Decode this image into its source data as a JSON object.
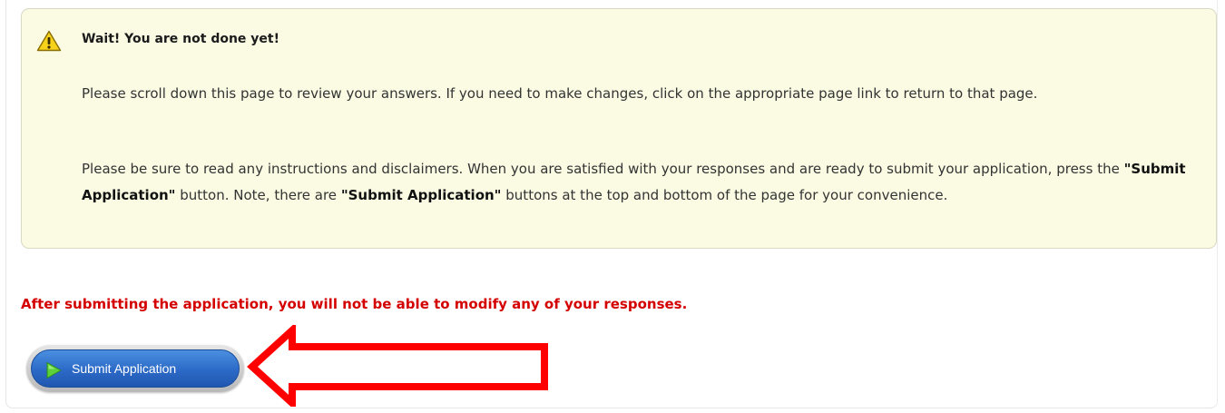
{
  "notice": {
    "icon": "warning-icon",
    "title": "Wait! You are not done yet!",
    "paragraph1": "Please scroll down this page to review your answers. If you need to make changes, click on the appropriate page link to return to that page.",
    "paragraph2_part1": "Please be sure to read any instructions and disclaimers. When you are satisfied with your responses and are ready to submit your application, press the ",
    "paragraph2_bold1": "\"Submit Application\"",
    "paragraph2_part2": " button. Note, there are ",
    "paragraph2_bold2": "\"Submit Application\"",
    "paragraph2_part3": " buttons at the top and bottom of the page for your convenience."
  },
  "warning_text": "After submitting the application, you will not be able to modify any of your responses.",
  "submit_button": {
    "label": "Submit Application",
    "icon": "play-icon"
  },
  "annotation": {
    "icon": "red-arrow-pointing-left-icon"
  },
  "colors": {
    "notice_background": "#fbfbe3",
    "warning_text": "#d40000",
    "button_blue": "#2c6ac7",
    "annotation_red": "#ff0000"
  }
}
